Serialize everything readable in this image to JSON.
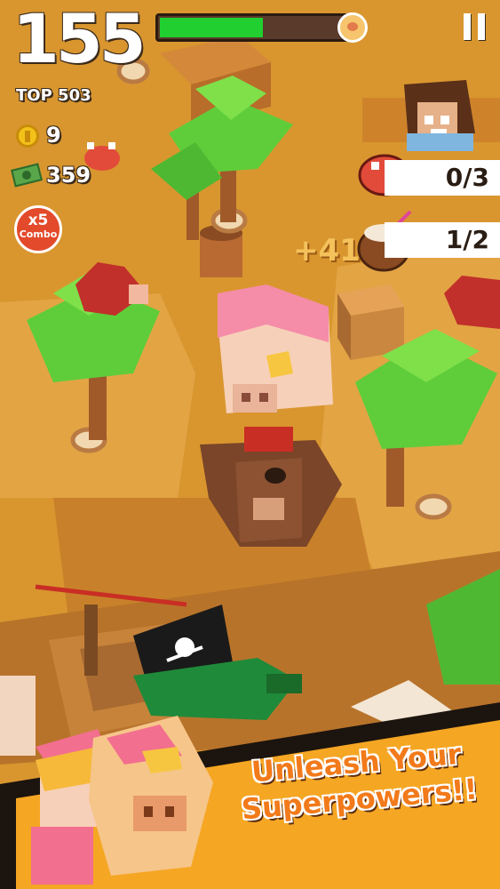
{
  "hud": {
    "score": "155",
    "top_score": "TOP 503",
    "coins": "9",
    "cash": "359",
    "combo_multiplier": "x5",
    "combo_label": "Combo",
    "level_progress": 0.56,
    "pause_icon": "pause-icon"
  },
  "quests": [
    {
      "icon": "crab-icon",
      "progress": "0/3"
    },
    {
      "icon": "coconut-drink-icon",
      "progress": "1/2"
    }
  ],
  "floating_points": "+41",
  "promo": {
    "line1": "Unleash Your",
    "line2": "Superpowers!!"
  },
  "colors": {
    "ground": "#d9962f",
    "progress_green": "#21d030",
    "banner_orange": "#f27a1a",
    "banner_bg": "#f5a623"
  }
}
